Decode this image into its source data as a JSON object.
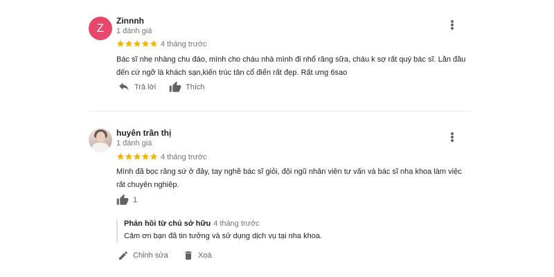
{
  "reviews": [
    {
      "avatar_letter": "Z",
      "avatar_color": "#e8476c",
      "name": "Zinnnh",
      "review_count": "1 đánh giá",
      "rating": 5,
      "time": "4 tháng trước",
      "text_line1": "Bác sĩ nhẹ nhàng chu đáo, mình cho cháu nhà mình đi nhổ răng sữa, cháu k sợ rất quý bác sĩ. Lần đầu",
      "text_line2": "đến cứ ngỡ là khách sạn,kiến trúc tân cổ điển rất đẹp. Rất ưng 6sao",
      "reply_label": "Trả lời",
      "like_label": "Thích"
    },
    {
      "name": "huyên trần thị",
      "review_count": "1 đánh giá",
      "rating": 5,
      "time": "4 tháng trước",
      "text_line1": "Mình đã bọc răng sứ ở đây, tay nghề bác sĩ giỏi, đội ngũ nhân viên tư vấn và bác sĩ nha khoa làm việc",
      "text_line2": "rất chuyên nghiệp.",
      "like_count": "1",
      "owner_reply": {
        "title": "Phản hồi từ chủ sở hữu",
        "time": "4 tháng trước",
        "text": "Cảm ơn bạn đã tin tưởng và sử dụng dịch vụ tại nha khoa."
      },
      "edit_label": "Chỉnh sửa",
      "delete_label": "Xoá"
    }
  ],
  "colors": {
    "star": "#f4b400",
    "secondary_text": "#70757a",
    "icon": "#5f6368"
  },
  "icons": [
    "more-vert-icon",
    "reply-icon",
    "thumb-up-icon",
    "edit-pencil-icon",
    "delete-trash-icon",
    "star-icon"
  ]
}
